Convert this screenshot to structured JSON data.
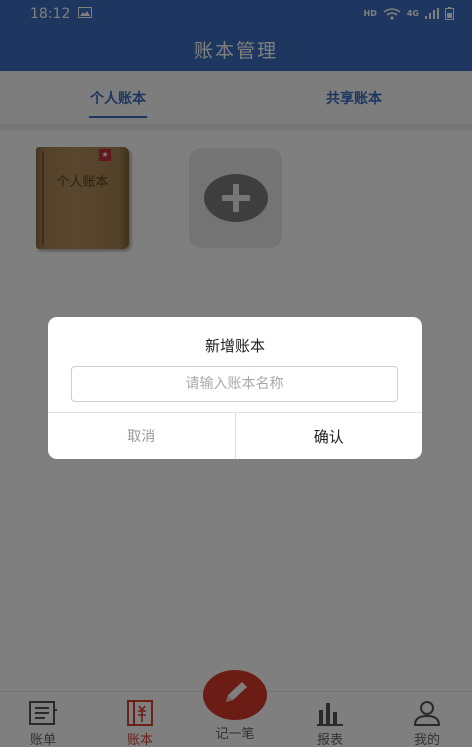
{
  "status_bar": {
    "time": "18:12",
    "indicators": [
      "image-icon",
      "hd-icon",
      "wifi-icon",
      "4g-icon",
      "signal-icon",
      "battery-icon"
    ],
    "hd_label": "HD",
    "network_label": "4G"
  },
  "header": {
    "title": "账本管理"
  },
  "tabs": [
    {
      "label": "个人账本",
      "active": true
    },
    {
      "label": "共享账本",
      "active": false
    }
  ],
  "ledgers": [
    {
      "name": "个人账本",
      "badge": "★"
    }
  ],
  "add_ledger": {
    "icon": "plus-icon"
  },
  "dialog": {
    "title": "新增账本",
    "input_placeholder": "请输入账本名称",
    "input_value": "",
    "cancel_label": "取消",
    "confirm_label": "确认"
  },
  "bottom_nav": {
    "items": [
      {
        "label": "账单",
        "icon": "bill-icon",
        "active": false
      },
      {
        "label": "账本",
        "icon": "ledger-icon",
        "active": true
      },
      {
        "label": "记一笔",
        "icon": "pencil-icon",
        "active": false
      },
      {
        "label": "报表",
        "icon": "chart-icon",
        "active": false
      },
      {
        "label": "我的",
        "icon": "user-icon",
        "active": false
      }
    ]
  },
  "colors": {
    "primary": "#3a6fc0",
    "accent": "#d63b2b"
  }
}
